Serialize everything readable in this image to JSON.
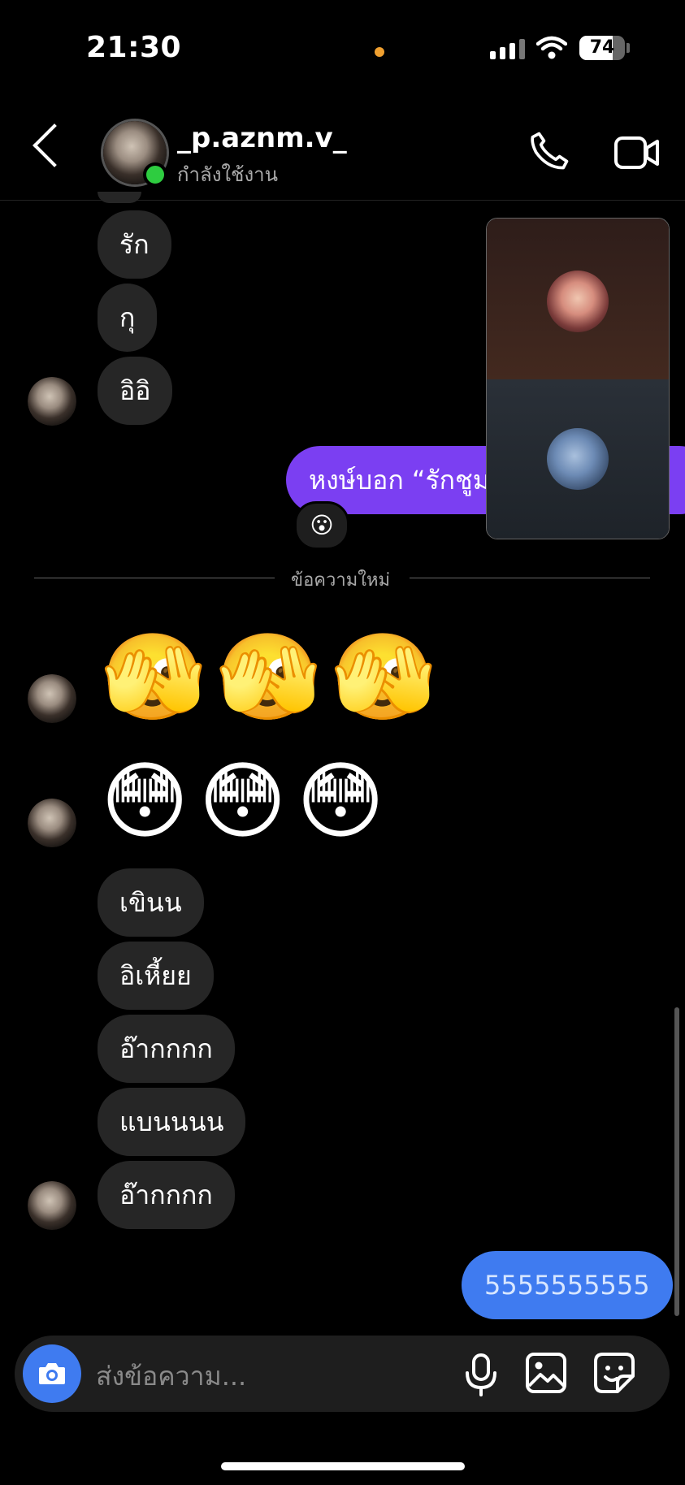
{
  "status_bar": {
    "time": "21:30",
    "battery": "74",
    "battery_level": 0.74
  },
  "header": {
    "username": "_p.aznm.v_",
    "status": "กำลังใช้งาน"
  },
  "messages_top": [
    {
      "text": "รัก"
    },
    {
      "text": "กุ"
    },
    {
      "text": "อิอิ"
    }
  ],
  "sent_purple": {
    "text": "หงษ์บอก “รักชูม",
    "reaction": "😮"
  },
  "divider": {
    "label": "ข้อความใหม่"
  },
  "emoji_rows": [
    {
      "text": "🫣🫣🫣"
    },
    {
      "text": "😳😳😳"
    }
  ],
  "messages_bottom": [
    {
      "text": "เขินน"
    },
    {
      "text": "อิเหี้ยย"
    },
    {
      "text": "อ๊ากกกก"
    },
    {
      "text": "แบนนนน"
    },
    {
      "text": "อ๊ากกกก"
    }
  ],
  "sent_blue": {
    "text": "5555555555"
  },
  "composer": {
    "placeholder": "ส่งข้อความ..."
  },
  "colors": {
    "sent_purple": "#7b3ff2",
    "sent_blue": "#3f7bf0",
    "received": "#262626",
    "online": "#2ecc40"
  }
}
